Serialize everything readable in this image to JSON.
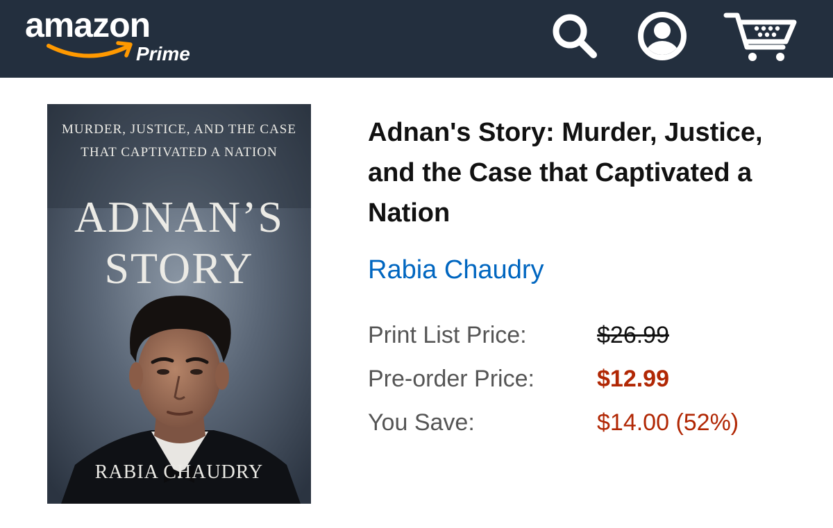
{
  "header": {
    "logo_word": "amazon",
    "logo_prime": "Prime",
    "icons": [
      "search-icon",
      "account-icon",
      "cart-icon"
    ],
    "background_color": "#232f3e",
    "accent_color": "#ff9900"
  },
  "book": {
    "cover": {
      "tagline": "MURDER, JUSTICE, AND THE CASE THAT CAPTIVATED A NATION",
      "title_line1": "ADNAN’S",
      "title_line2": "STORY",
      "author": "RABIA CHAUDRY"
    },
    "title": "Adnan's Story: Murder, Justice, and the Case that Captivated a Nation",
    "author": "Rabia Chaudry"
  },
  "pricing": {
    "list_label": "Print List Price:",
    "list_value": "$26.99",
    "preorder_label": "Pre-order Price:",
    "preorder_value": "$12.99",
    "save_label": "You Save:",
    "save_value": "$14.00 (52%)",
    "price_color": "#b12704"
  },
  "colors": {
    "link": "#0066c0"
  }
}
